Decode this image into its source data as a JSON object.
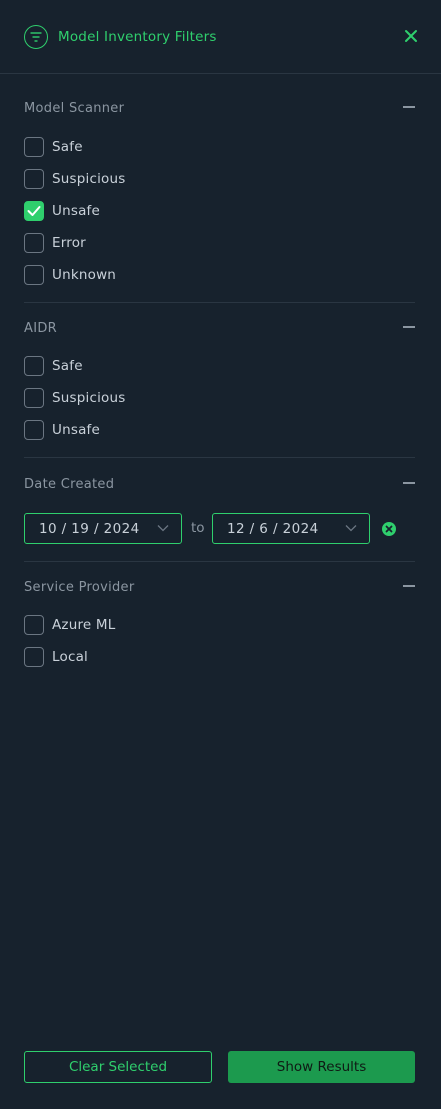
{
  "header": {
    "title": "Model Inventory Filters"
  },
  "sections": {
    "model_scanner": {
      "title": "Model Scanner",
      "options": [
        {
          "label": "Safe",
          "checked": false
        },
        {
          "label": "Suspicious",
          "checked": false
        },
        {
          "label": "Unsafe",
          "checked": true
        },
        {
          "label": "Error",
          "checked": false
        },
        {
          "label": "Unknown",
          "checked": false
        }
      ]
    },
    "aidr": {
      "title": "AIDR",
      "options": [
        {
          "label": "Safe",
          "checked": false
        },
        {
          "label": "Suspicious",
          "checked": false
        },
        {
          "label": "Unsafe",
          "checked": false
        }
      ]
    },
    "date_created": {
      "title": "Date Created",
      "from": "10 / 19 / 2024",
      "to_label": "to",
      "to": "12 / 6 / 2024"
    },
    "service_provider": {
      "title": "Service Provider",
      "options": [
        {
          "label": "Azure ML",
          "checked": false
        },
        {
          "label": "Local",
          "checked": false
        }
      ]
    }
  },
  "footer": {
    "clear_label": "Clear Selected",
    "show_label": "Show Results"
  },
  "colors": {
    "accent": "#2fcf6d",
    "background": "#17222d",
    "muted": "#8b96a1"
  }
}
